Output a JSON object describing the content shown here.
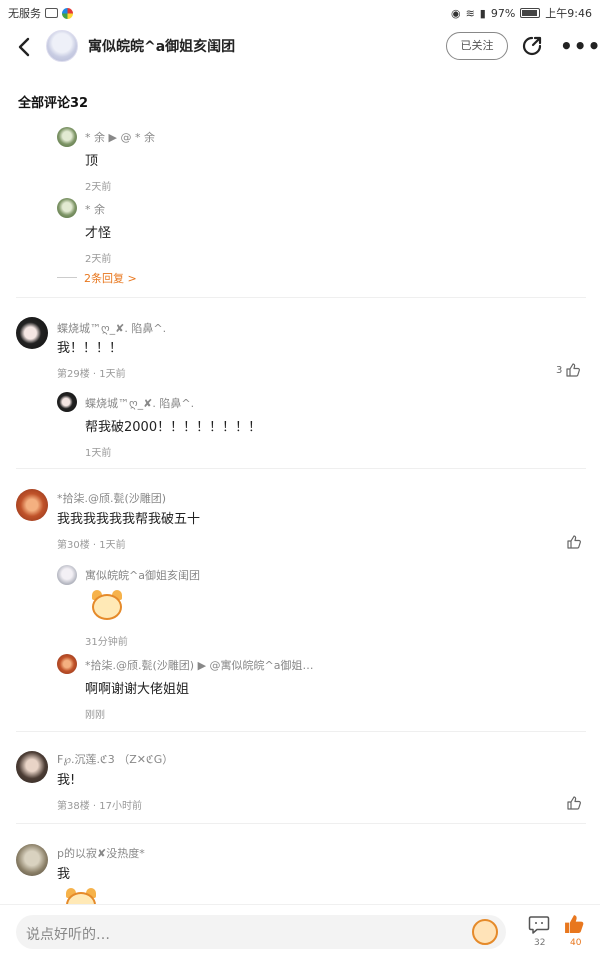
{
  "status_bar": {
    "carrier": "无服务",
    "battery": "97%",
    "time": "上午9:46"
  },
  "header": {
    "title": "寓似皖皖^a御姐亥闺团",
    "follow_label": "已关注"
  },
  "comments_header": "全部评论32",
  "thread0": {
    "reply1": {
      "user": "* 余 ▶ @ * 余",
      "text": "顶",
      "time": "2天前"
    },
    "reply2": {
      "user": "* 余",
      "text": "才怪",
      "time": "2天前"
    },
    "more_replies": "2条回复 >"
  },
  "comment29": {
    "user": "蝶烧城™ღ_✘. 陷鼻^.",
    "text": "我！！！！",
    "meta": "第29楼 · 1天前",
    "likes": "3",
    "reply": {
      "user": "蝶烧城™ღ_✘. 陷鼻^.",
      "text": "帮我破2000！！！！！！！！",
      "time": "1天前"
    }
  },
  "comment30": {
    "user": "*拾柒.@颀.甏(沙雕团)",
    "text": "我我我我我我帮我破五十",
    "meta": "第30楼 · 1天前",
    "reply1": {
      "user": "寓似皖皖^a御姐亥闺团",
      "time": "31分钟前"
    },
    "reply2": {
      "user": "*拾柒.@颀.甏(沙雕团) ▶ @寓似皖皖^a御姐…",
      "text": "啊啊谢谢大佬姐姐",
      "time": "刚刚"
    }
  },
  "comment38": {
    "user": "F℘.沉莲.ℭ3 （Z✕ℭG）",
    "text": "我!",
    "meta": "第38楼 · 17小时前"
  },
  "comment_last": {
    "user": "p的以寂✘没热度*",
    "text": "我"
  },
  "bottom_bar": {
    "placeholder": "说点好听的…",
    "comment_count": "32",
    "like_count": "40"
  },
  "colors": {
    "accent": "#e8771e",
    "text": "#222222",
    "muted": "#888888"
  },
  "icons": [
    "back-icon",
    "share-icon",
    "more-icon",
    "thumb-up-icon",
    "comment-icon",
    "emoji-icon"
  ]
}
